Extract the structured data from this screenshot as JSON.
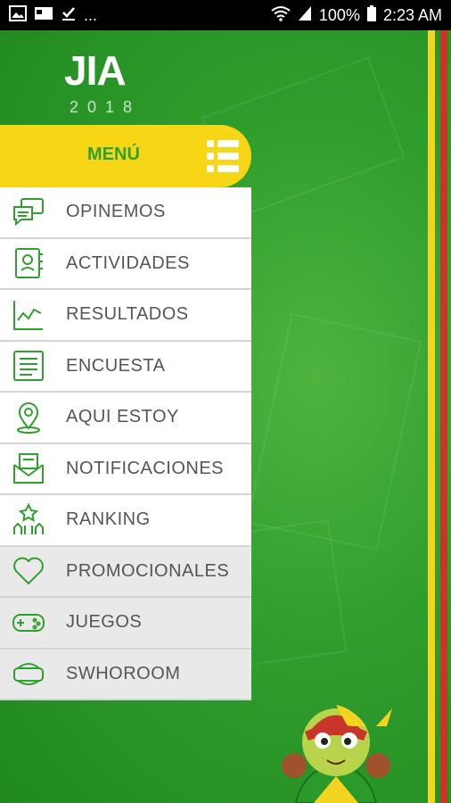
{
  "status_bar": {
    "battery": "100%",
    "time": "2:23 AM",
    "more": "..."
  },
  "logo": {
    "text": "JIA",
    "year": "2018"
  },
  "menu": {
    "title": "MENÚ",
    "items": [
      {
        "label": "OPINEMOS",
        "icon": "chat-icon"
      },
      {
        "label": "ACTIVIDADES",
        "icon": "activities-icon"
      },
      {
        "label": "RESULTADOS",
        "icon": "chart-icon"
      },
      {
        "label": "ENCUESTA",
        "icon": "survey-icon"
      },
      {
        "label": "AQUI ESTOY",
        "icon": "location-pin-icon"
      },
      {
        "label": "NOTIFICACIONES",
        "icon": "envelope-icon"
      },
      {
        "label": "RANKING",
        "icon": "ranking-icon"
      },
      {
        "label": "PROMOCIONALES",
        "icon": "heart-icon"
      },
      {
        "label": "JUEGOS",
        "icon": "gamepad-icon"
      },
      {
        "label": "SWHOROOM",
        "icon": "vr-headset-icon"
      }
    ]
  },
  "colors": {
    "green": "#2f9d2c",
    "yellow": "#f7d616",
    "red": "#c8362b"
  }
}
